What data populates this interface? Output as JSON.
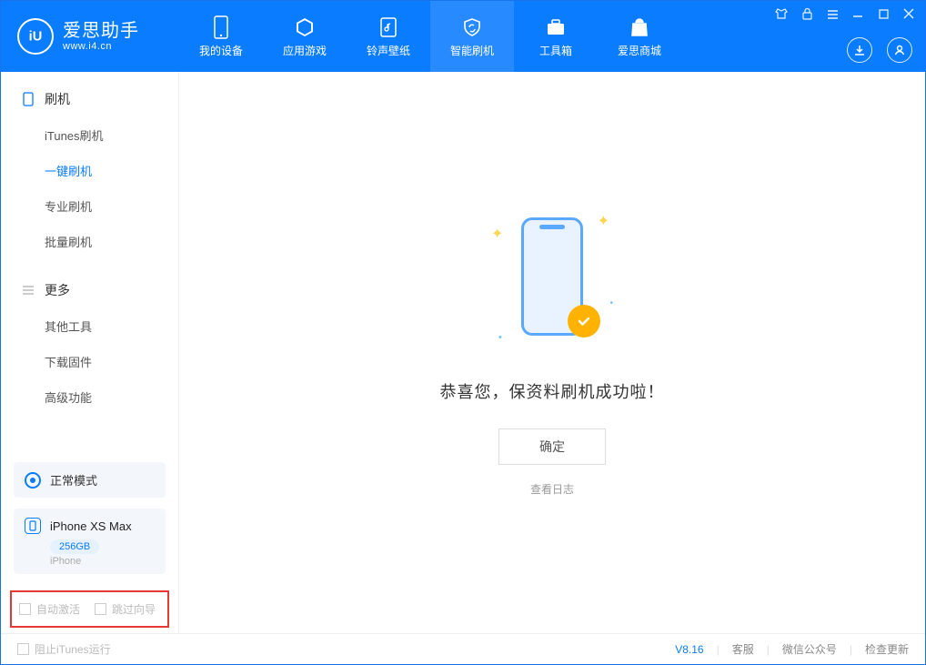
{
  "app": {
    "title": "爱思助手",
    "url": "www.i4.cn"
  },
  "nav": [
    {
      "label": "我的设备"
    },
    {
      "label": "应用游戏"
    },
    {
      "label": "铃声壁纸"
    },
    {
      "label": "智能刷机"
    },
    {
      "label": "工具箱"
    },
    {
      "label": "爱思商城"
    }
  ],
  "sidebar": {
    "section1": {
      "title": "刷机",
      "items": [
        "iTunes刷机",
        "一键刷机",
        "专业刷机",
        "批量刷机"
      ]
    },
    "section2": {
      "title": "更多",
      "items": [
        "其他工具",
        "下载固件",
        "高级功能"
      ]
    },
    "mode_label": "正常模式",
    "device": {
      "name": "iPhone XS Max",
      "capacity": "256GB",
      "type": "iPhone"
    },
    "checkbox1": "自动激活",
    "checkbox2": "跳过向导"
  },
  "main": {
    "success_text": "恭喜您，保资料刷机成功啦！",
    "ok_button": "确定",
    "view_log": "查看日志"
  },
  "footer": {
    "block_itunes": "阻止iTunes运行",
    "version": "V8.16",
    "links": [
      "客服",
      "微信公众号",
      "检查更新"
    ]
  }
}
